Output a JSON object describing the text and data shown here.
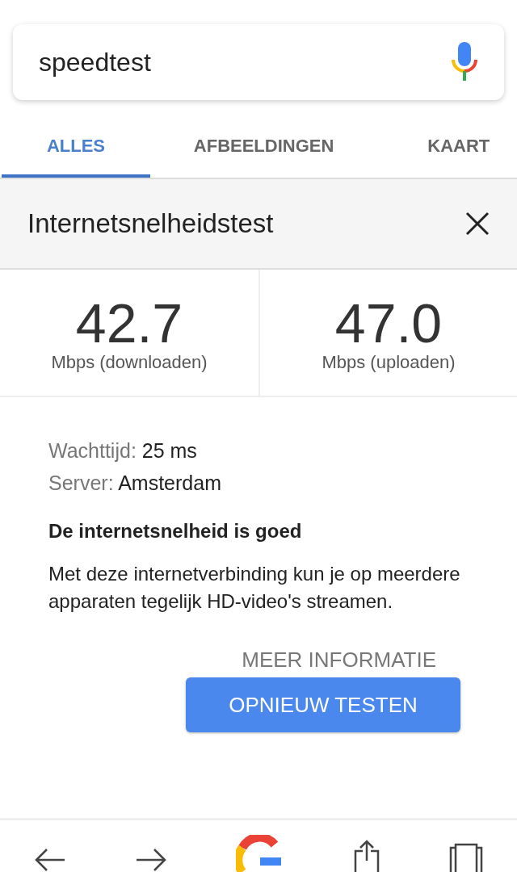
{
  "search": {
    "value": "speedtest"
  },
  "tabs": [
    {
      "label": "ALLES",
      "selected": true
    },
    {
      "label": "AFBEELDINGEN",
      "selected": false
    },
    {
      "label": "KAART",
      "selected": false
    }
  ],
  "card": {
    "title": "Internetsnelheidstest",
    "speeds": [
      {
        "value": "42.7",
        "unit": "Mbps (downloaden)"
      },
      {
        "value": "47.0",
        "unit": "Mbps (uploaden)"
      }
    ],
    "details": [
      {
        "label": "Wachttijd:",
        "value": "25 ms"
      },
      {
        "label": "Server:",
        "value": "Amsterdam"
      }
    ],
    "verdict": "De internetsnelheid is goed",
    "description": "Met deze internetverbinding kun je op meerdere apparaten tegelijk HD-video's streamen.",
    "more_link": "MEER INFORMATIE",
    "retest_button": "OPNIEUW TESTEN"
  }
}
